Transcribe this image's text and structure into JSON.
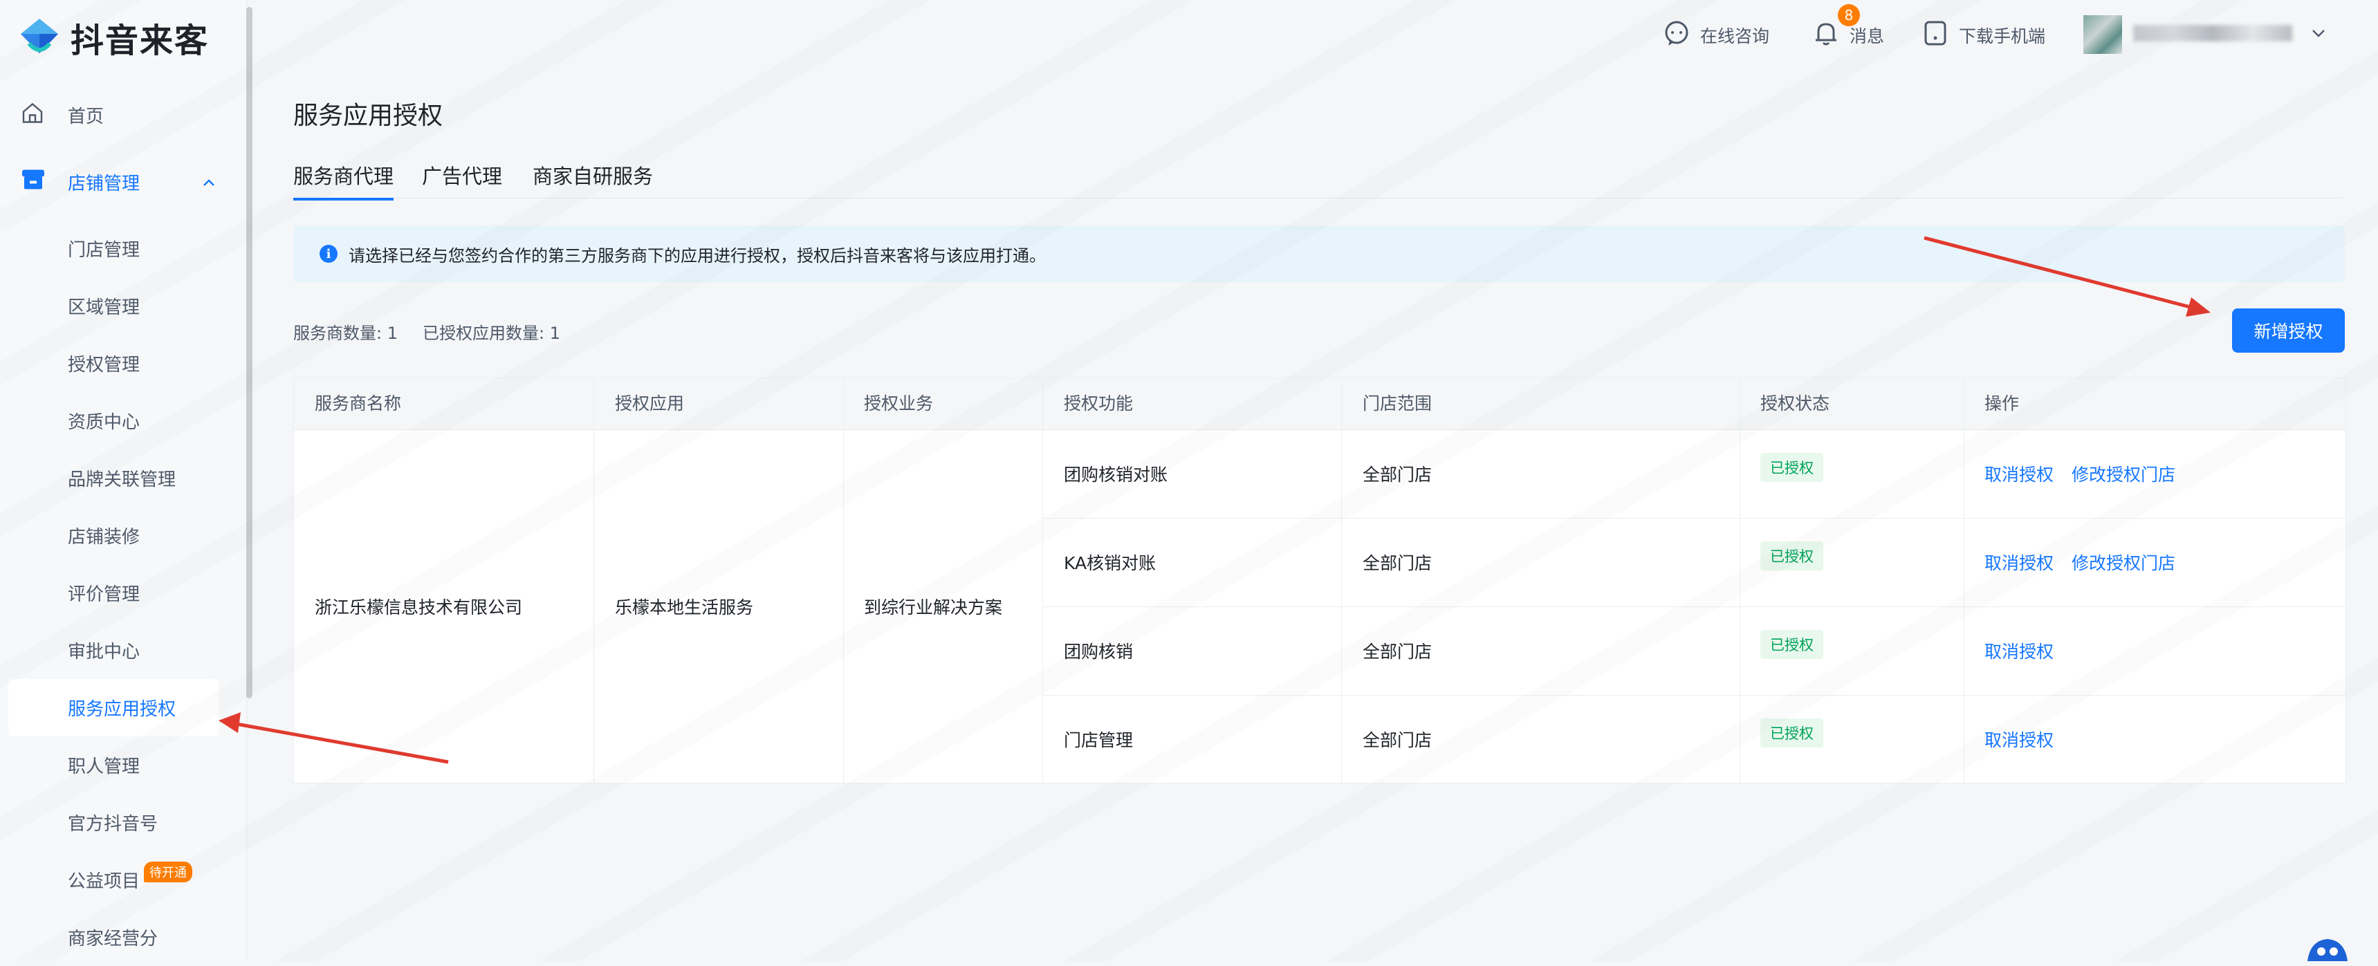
{
  "app": {
    "name": "抖音来客"
  },
  "sidebar": {
    "items": [
      {
        "label": "首页"
      },
      {
        "label": "店铺管理"
      },
      {
        "label": "门店管理"
      },
      {
        "label": "区域管理"
      },
      {
        "label": "授权管理"
      },
      {
        "label": "资质中心"
      },
      {
        "label": "品牌关联管理"
      },
      {
        "label": "店铺装修"
      },
      {
        "label": "评价管理"
      },
      {
        "label": "审批中心"
      },
      {
        "label": "服务应用授权"
      },
      {
        "label": "职人管理"
      },
      {
        "label": "官方抖音号"
      },
      {
        "label": "公益项目",
        "badge": "待开通"
      },
      {
        "label": "商家经营分"
      }
    ]
  },
  "header": {
    "consult_label": "在线咨询",
    "messages_label": "消息",
    "messages_count": "8",
    "download_label": "下载手机端"
  },
  "page": {
    "title": "服务应用授权",
    "tabs": [
      {
        "label": "服务商代理"
      },
      {
        "label": "广告代理"
      },
      {
        "label": "商家自研服务"
      }
    ],
    "notice": "请选择已经与您签约合作的第三方服务商下的应用进行授权，授权后抖音来客将与该应用打通。",
    "stats": {
      "providers": "服务商数量: 1",
      "apps": "已授权应用数量: 1"
    },
    "add_button": "新增授权"
  },
  "table": {
    "columns": [
      "服务商名称",
      "授权应用",
      "授权业务",
      "授权功能",
      "门店范围",
      "授权状态",
      "操作"
    ],
    "provider": "浙江乐檬信息技术有限公司",
    "app": "乐檬本地生活服务",
    "business": "到综行业解决方案",
    "rows": [
      {
        "function": "团购核销对账",
        "scope": "全部门店",
        "status": "已授权",
        "actions": [
          "取消授权",
          "修改授权门店"
        ]
      },
      {
        "function": "KA核销对账",
        "scope": "全部门店",
        "status": "已授权",
        "actions": [
          "取消授权",
          "修改授权门店"
        ]
      },
      {
        "function": "团购核销",
        "scope": "全部门店",
        "status": "已授权",
        "actions": [
          "取消授权"
        ]
      },
      {
        "function": "门店管理",
        "scope": "全部门店",
        "status": "已授权",
        "actions": [
          "取消授权"
        ]
      }
    ]
  },
  "colors": {
    "accent": "#1677ff",
    "success": "#00a35a",
    "annotation": "#e03a2f",
    "badge": "#ff7d00"
  }
}
